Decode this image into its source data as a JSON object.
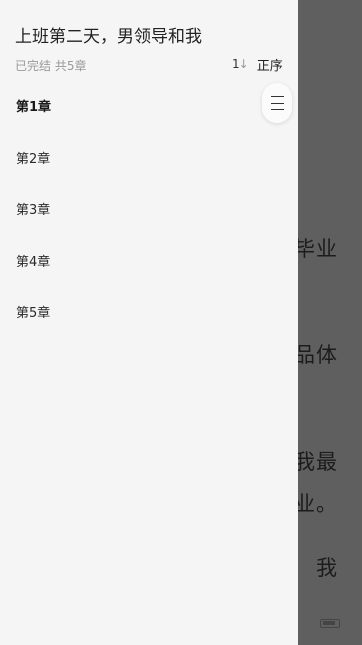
{
  "reader": {
    "lines": [
      {
        "text": "毕业"
      },
      {
        "text": "品体"
      },
      {
        "text": "我最"
      },
      {
        "text": "作业。"
      },
      {
        "text": "我"
      }
    ]
  },
  "drawer": {
    "book_title": "上班第二天，男领导和我",
    "meta": "已完结 共5章",
    "sort": {
      "icon": "sort-order-icon",
      "label": "正序"
    },
    "chapters": [
      {
        "label": "第1章",
        "current": true
      },
      {
        "label": "第2章",
        "current": false
      },
      {
        "label": "第3章",
        "current": false
      },
      {
        "label": "第4章",
        "current": false
      },
      {
        "label": "第5章",
        "current": false
      }
    ],
    "scroll_handle_icon": "menu-lines-icon"
  },
  "colors": {
    "drawer_bg": "#f5f5f5",
    "overlay": "#5f5f5f",
    "text_primary": "#222222",
    "text_secondary": "#9a9a9a"
  }
}
